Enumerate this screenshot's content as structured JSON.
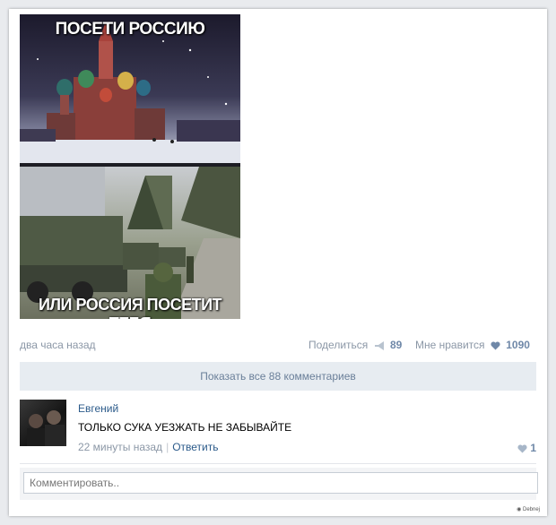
{
  "post": {
    "image": {
      "caption_top": "ПОСЕТИ РОССИЮ",
      "caption_bottom": "ИЛИ РОССИЯ ПОСЕТИТ ТЕБЯ"
    },
    "time": "два часа назад",
    "share_label": "Поделиться",
    "share_count": "89",
    "like_label": "Мне нравится",
    "like_count": "1090",
    "icons": {
      "share": "megaphone-icon",
      "like": "heart-icon"
    }
  },
  "comments": {
    "show_all_label": "Показать все 88 комментариев",
    "items": [
      {
        "author": "Евгений",
        "text": "ТОЛЬКО СУКА УЕЗЖАТЬ НЕ ЗАБЫВАЙТЕ",
        "time": "22 минуты назад",
        "reply_label": "Ответить",
        "likes": "1"
      }
    ]
  },
  "composer": {
    "placeholder": "Комментировать.."
  },
  "colors": {
    "accent": "#2b5a8a",
    "muted": "#8b97a6",
    "button_bg": "#e7ecf1"
  }
}
